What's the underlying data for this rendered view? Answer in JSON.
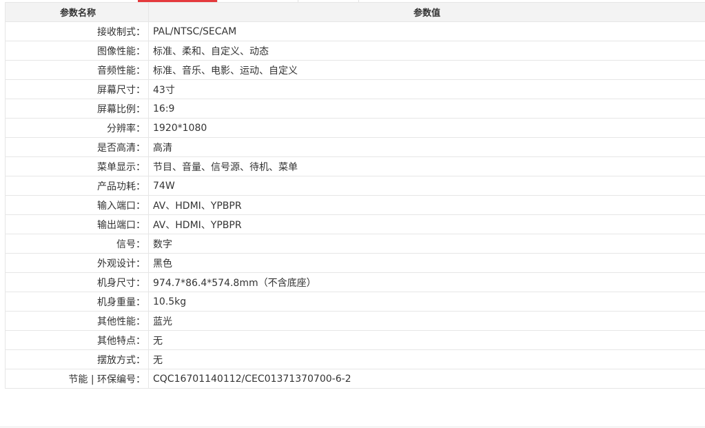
{
  "table": {
    "header": {
      "name_label": "参数名称",
      "value_label": "参数值"
    },
    "rows": [
      {
        "name": "接收制式：",
        "value": "PAL/NTSC/SECAM"
      },
      {
        "name": "图像性能：",
        "value": "标准、柔和、自定义、动态"
      },
      {
        "name": "音频性能：",
        "value": "标准、音乐、电影、运动、自定义"
      },
      {
        "name": "屏幕尺寸：",
        "value": "43寸"
      },
      {
        "name": "屏幕比例：",
        "value": "16:9"
      },
      {
        "name": "分辨率：",
        "value": "1920*1080"
      },
      {
        "name": "是否高清：",
        "value": "高清"
      },
      {
        "name": "菜单显示：",
        "value": "节目、音量、信号源、待机、菜单"
      },
      {
        "name": "产品功耗：",
        "value": "74W"
      },
      {
        "name": "输入端口：",
        "value": "AV、HDMI、YPBPR"
      },
      {
        "name": "输出端口：",
        "value": "AV、HDMI、YPBPR"
      },
      {
        "name": "信号：",
        "value": "数字"
      },
      {
        "name": "外观设计：",
        "value": "黑色"
      },
      {
        "name": "机身尺寸：",
        "value": "974.7*86.4*574.8mm（不含底座）"
      },
      {
        "name": "机身重量：",
        "value": "10.5kg"
      },
      {
        "name": "其他性能：",
        "value": "蓝光"
      },
      {
        "name": "其他特点：",
        "value": "无"
      },
      {
        "name": "摆放方式：",
        "value": "无"
      },
      {
        "name": "节能 | 环保编号：",
        "value": "CQC16701140112/CEC01371370700-6-2"
      }
    ]
  },
  "colors": {
    "active_tab": "#e4393c",
    "header_bg": "#f3f3f3",
    "border": "#e6e6e6",
    "text": "#333333"
  }
}
